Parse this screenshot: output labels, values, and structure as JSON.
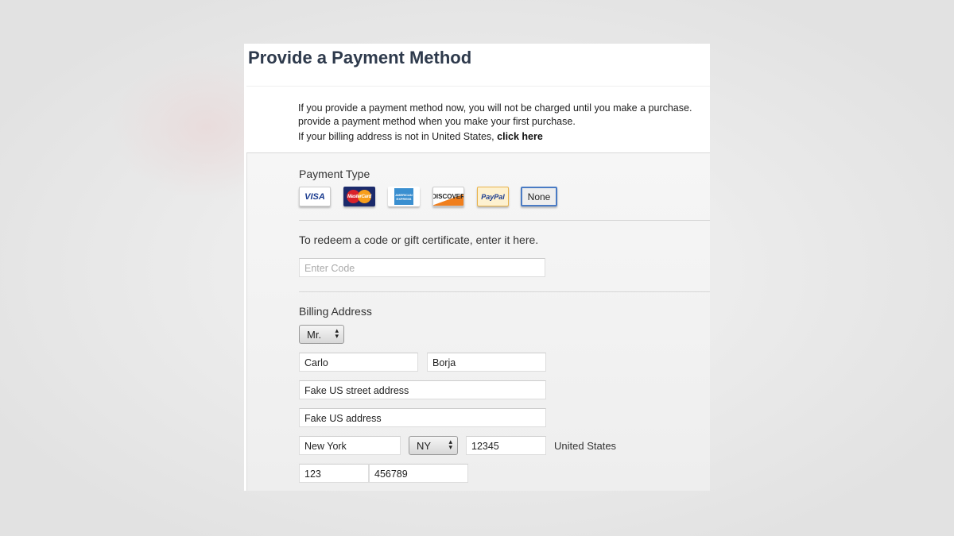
{
  "title": "Provide a Payment Method",
  "info": {
    "line1": "If you provide a payment method now, you will not be charged until you make a purchase.",
    "line2": "provide a payment method when you make your first purchase.",
    "line3": "If your billing address is not in United States, ",
    "link": "click here"
  },
  "payment": {
    "label": "Payment Type",
    "cards": [
      "VISA",
      "MasterCard",
      "American Express",
      "DISCOVER",
      "PayPal"
    ],
    "none": "None",
    "selected": "None"
  },
  "redeem": {
    "label": "To redeem a code or gift certificate, enter it here.",
    "placeholder": "Enter Code"
  },
  "billing": {
    "label": "Billing Address",
    "salutation": "Mr.",
    "first_name": "Carlo",
    "last_name": "Borja",
    "street": "Fake US street address",
    "street2": "Fake US address",
    "city": "New York",
    "state": "NY",
    "zip": "12345",
    "country": "United States",
    "area_code": "123",
    "phone": "456789"
  }
}
